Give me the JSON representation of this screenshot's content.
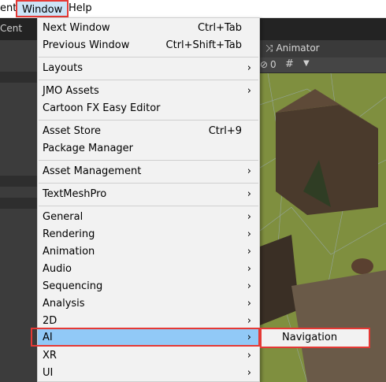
{
  "menubar": {
    "component_label": "ent",
    "window_label": "Window",
    "help_label": "Help"
  },
  "editor": {
    "left_toolbar_text": "Cent",
    "animator_tab": "Animator",
    "scene_icons": [
      "visibility-off-icon",
      "grid-icon",
      "dropdown-icon"
    ],
    "scene_text": "0"
  },
  "window_menu": {
    "items": [
      {
        "label": "Next Window",
        "shortcut": "Ctrl+Tab",
        "submenu": false
      },
      {
        "label": "Previous Window",
        "shortcut": "Ctrl+Shift+Tab",
        "submenu": false
      },
      {
        "label": "Layouts",
        "shortcut": "",
        "submenu": true
      },
      {
        "label": "JMO Assets",
        "shortcut": "",
        "submenu": true
      },
      {
        "label": "Cartoon FX Easy Editor",
        "shortcut": "",
        "submenu": false
      },
      {
        "label": "Asset Store",
        "shortcut": "Ctrl+9",
        "submenu": false
      },
      {
        "label": "Package Manager",
        "shortcut": "",
        "submenu": false
      },
      {
        "label": "Asset Management",
        "shortcut": "",
        "submenu": true
      },
      {
        "label": "TextMeshPro",
        "shortcut": "",
        "submenu": true
      },
      {
        "label": "General",
        "shortcut": "",
        "submenu": true
      },
      {
        "label": "Rendering",
        "shortcut": "",
        "submenu": true
      },
      {
        "label": "Animation",
        "shortcut": "",
        "submenu": true
      },
      {
        "label": "Audio",
        "shortcut": "",
        "submenu": true
      },
      {
        "label": "Sequencing",
        "shortcut": "",
        "submenu": true
      },
      {
        "label": "Analysis",
        "shortcut": "",
        "submenu": true
      },
      {
        "label": "2D",
        "shortcut": "",
        "submenu": true
      },
      {
        "label": "AI",
        "shortcut": "",
        "submenu": true,
        "highlighted": true
      },
      {
        "label": "XR",
        "shortcut": "",
        "submenu": true
      },
      {
        "label": "UI",
        "shortcut": "",
        "submenu": true
      }
    ],
    "arrow_glyph": "›"
  },
  "ai_submenu": {
    "items": [
      {
        "label": "Navigation"
      }
    ]
  },
  "colors": {
    "highlight": "#91c9f7",
    "annotation_red": "#e53935",
    "menu_bg": "#f2f2f2"
  }
}
